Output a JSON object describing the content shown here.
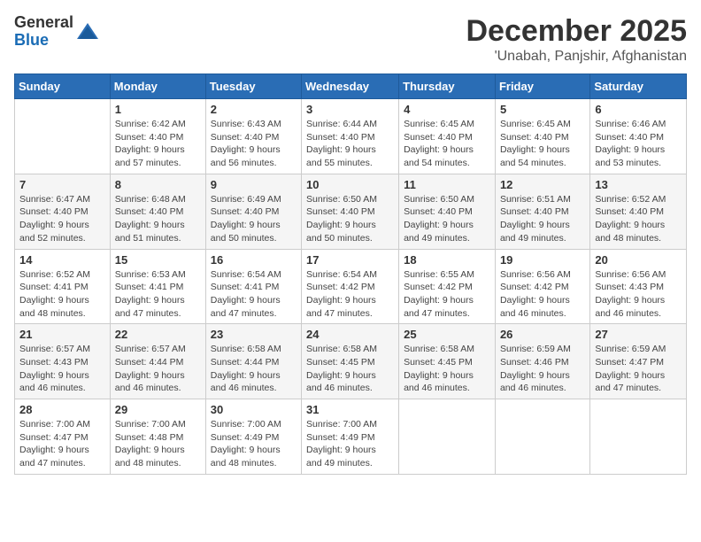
{
  "header": {
    "logo_general": "General",
    "logo_blue": "Blue",
    "month_title": "December 2025",
    "location": "'Unabah, Panjshir, Afghanistan"
  },
  "weekdays": [
    "Sunday",
    "Monday",
    "Tuesday",
    "Wednesday",
    "Thursday",
    "Friday",
    "Saturday"
  ],
  "weeks": [
    [
      {
        "day": "",
        "sunrise": "",
        "sunset": "",
        "daylight": ""
      },
      {
        "day": "1",
        "sunrise": "Sunrise: 6:42 AM",
        "sunset": "Sunset: 4:40 PM",
        "daylight": "Daylight: 9 hours and 57 minutes."
      },
      {
        "day": "2",
        "sunrise": "Sunrise: 6:43 AM",
        "sunset": "Sunset: 4:40 PM",
        "daylight": "Daylight: 9 hours and 56 minutes."
      },
      {
        "day": "3",
        "sunrise": "Sunrise: 6:44 AM",
        "sunset": "Sunset: 4:40 PM",
        "daylight": "Daylight: 9 hours and 55 minutes."
      },
      {
        "day": "4",
        "sunrise": "Sunrise: 6:45 AM",
        "sunset": "Sunset: 4:40 PM",
        "daylight": "Daylight: 9 hours and 54 minutes."
      },
      {
        "day": "5",
        "sunrise": "Sunrise: 6:45 AM",
        "sunset": "Sunset: 4:40 PM",
        "daylight": "Daylight: 9 hours and 54 minutes."
      },
      {
        "day": "6",
        "sunrise": "Sunrise: 6:46 AM",
        "sunset": "Sunset: 4:40 PM",
        "daylight": "Daylight: 9 hours and 53 minutes."
      }
    ],
    [
      {
        "day": "7",
        "sunrise": "Sunrise: 6:47 AM",
        "sunset": "Sunset: 4:40 PM",
        "daylight": "Daylight: 9 hours and 52 minutes."
      },
      {
        "day": "8",
        "sunrise": "Sunrise: 6:48 AM",
        "sunset": "Sunset: 4:40 PM",
        "daylight": "Daylight: 9 hours and 51 minutes."
      },
      {
        "day": "9",
        "sunrise": "Sunrise: 6:49 AM",
        "sunset": "Sunset: 4:40 PM",
        "daylight": "Daylight: 9 hours and 50 minutes."
      },
      {
        "day": "10",
        "sunrise": "Sunrise: 6:50 AM",
        "sunset": "Sunset: 4:40 PM",
        "daylight": "Daylight: 9 hours and 50 minutes."
      },
      {
        "day": "11",
        "sunrise": "Sunrise: 6:50 AM",
        "sunset": "Sunset: 4:40 PM",
        "daylight": "Daylight: 9 hours and 49 minutes."
      },
      {
        "day": "12",
        "sunrise": "Sunrise: 6:51 AM",
        "sunset": "Sunset: 4:40 PM",
        "daylight": "Daylight: 9 hours and 49 minutes."
      },
      {
        "day": "13",
        "sunrise": "Sunrise: 6:52 AM",
        "sunset": "Sunset: 4:40 PM",
        "daylight": "Daylight: 9 hours and 48 minutes."
      }
    ],
    [
      {
        "day": "14",
        "sunrise": "Sunrise: 6:52 AM",
        "sunset": "Sunset: 4:41 PM",
        "daylight": "Daylight: 9 hours and 48 minutes."
      },
      {
        "day": "15",
        "sunrise": "Sunrise: 6:53 AM",
        "sunset": "Sunset: 4:41 PM",
        "daylight": "Daylight: 9 hours and 47 minutes."
      },
      {
        "day": "16",
        "sunrise": "Sunrise: 6:54 AM",
        "sunset": "Sunset: 4:41 PM",
        "daylight": "Daylight: 9 hours and 47 minutes."
      },
      {
        "day": "17",
        "sunrise": "Sunrise: 6:54 AM",
        "sunset": "Sunset: 4:42 PM",
        "daylight": "Daylight: 9 hours and 47 minutes."
      },
      {
        "day": "18",
        "sunrise": "Sunrise: 6:55 AM",
        "sunset": "Sunset: 4:42 PM",
        "daylight": "Daylight: 9 hours and 47 minutes."
      },
      {
        "day": "19",
        "sunrise": "Sunrise: 6:56 AM",
        "sunset": "Sunset: 4:42 PM",
        "daylight": "Daylight: 9 hours and 46 minutes."
      },
      {
        "day": "20",
        "sunrise": "Sunrise: 6:56 AM",
        "sunset": "Sunset: 4:43 PM",
        "daylight": "Daylight: 9 hours and 46 minutes."
      }
    ],
    [
      {
        "day": "21",
        "sunrise": "Sunrise: 6:57 AM",
        "sunset": "Sunset: 4:43 PM",
        "daylight": "Daylight: 9 hours and 46 minutes."
      },
      {
        "day": "22",
        "sunrise": "Sunrise: 6:57 AM",
        "sunset": "Sunset: 4:44 PM",
        "daylight": "Daylight: 9 hours and 46 minutes."
      },
      {
        "day": "23",
        "sunrise": "Sunrise: 6:58 AM",
        "sunset": "Sunset: 4:44 PM",
        "daylight": "Daylight: 9 hours and 46 minutes."
      },
      {
        "day": "24",
        "sunrise": "Sunrise: 6:58 AM",
        "sunset": "Sunset: 4:45 PM",
        "daylight": "Daylight: 9 hours and 46 minutes."
      },
      {
        "day": "25",
        "sunrise": "Sunrise: 6:58 AM",
        "sunset": "Sunset: 4:45 PM",
        "daylight": "Daylight: 9 hours and 46 minutes."
      },
      {
        "day": "26",
        "sunrise": "Sunrise: 6:59 AM",
        "sunset": "Sunset: 4:46 PM",
        "daylight": "Daylight: 9 hours and 46 minutes."
      },
      {
        "day": "27",
        "sunrise": "Sunrise: 6:59 AM",
        "sunset": "Sunset: 4:47 PM",
        "daylight": "Daylight: 9 hours and 47 minutes."
      }
    ],
    [
      {
        "day": "28",
        "sunrise": "Sunrise: 7:00 AM",
        "sunset": "Sunset: 4:47 PM",
        "daylight": "Daylight: 9 hours and 47 minutes."
      },
      {
        "day": "29",
        "sunrise": "Sunrise: 7:00 AM",
        "sunset": "Sunset: 4:48 PM",
        "daylight": "Daylight: 9 hours and 48 minutes."
      },
      {
        "day": "30",
        "sunrise": "Sunrise: 7:00 AM",
        "sunset": "Sunset: 4:49 PM",
        "daylight": "Daylight: 9 hours and 48 minutes."
      },
      {
        "day": "31",
        "sunrise": "Sunrise: 7:00 AM",
        "sunset": "Sunset: 4:49 PM",
        "daylight": "Daylight: 9 hours and 49 minutes."
      },
      {
        "day": "",
        "sunrise": "",
        "sunset": "",
        "daylight": ""
      },
      {
        "day": "",
        "sunrise": "",
        "sunset": "",
        "daylight": ""
      },
      {
        "day": "",
        "sunrise": "",
        "sunset": "",
        "daylight": ""
      }
    ]
  ]
}
